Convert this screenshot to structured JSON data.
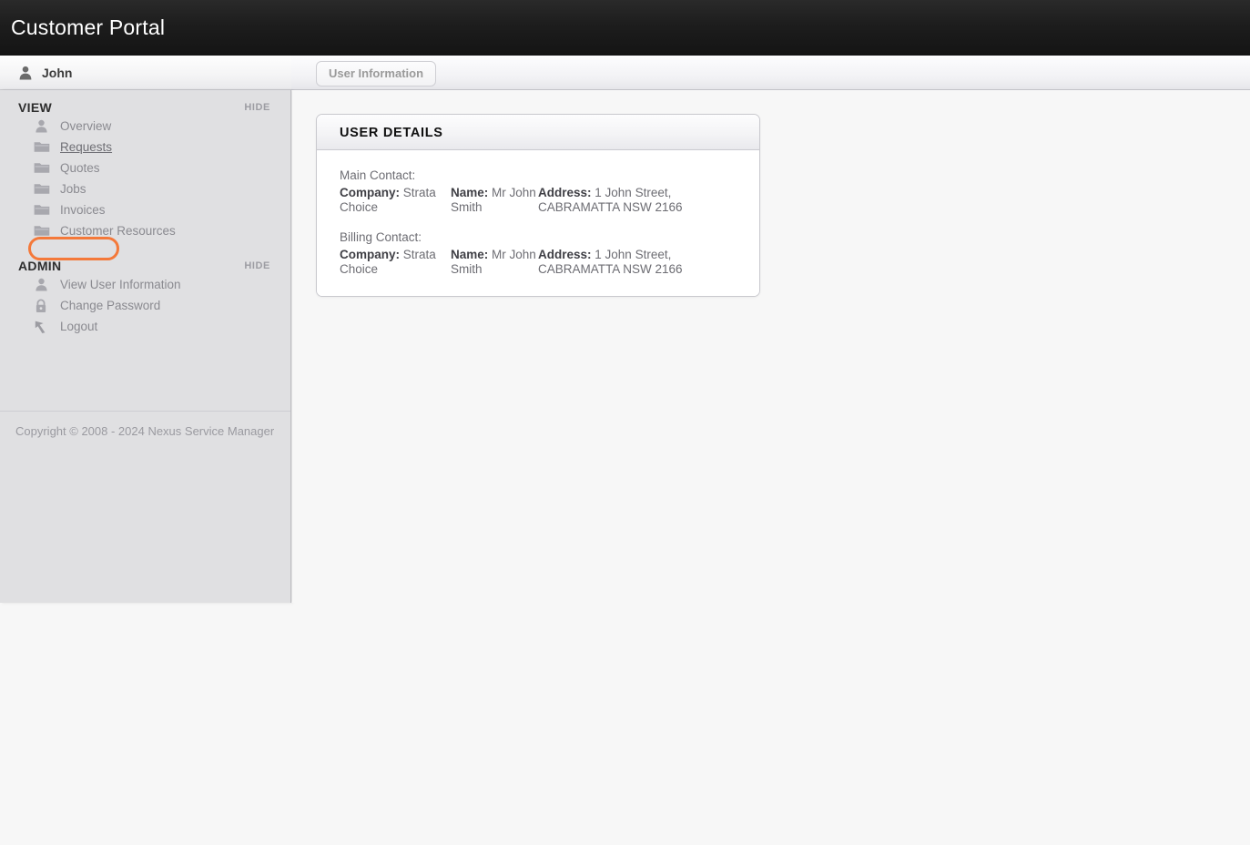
{
  "header": {
    "title": "Customer Portal"
  },
  "user": {
    "name": "John",
    "avatar_icon": "person-icon"
  },
  "toolbar": {
    "tabs": [
      {
        "label": "User Information",
        "active": true
      }
    ]
  },
  "sidebar": {
    "sections": [
      {
        "title": "VIEW",
        "hide_label": "HIDE",
        "items": [
          {
            "label": "Overview",
            "icon": "person-icon",
            "highlighted": false
          },
          {
            "label": "Requests",
            "icon": "folder-icon",
            "highlighted": true
          },
          {
            "label": "Quotes",
            "icon": "folder-icon",
            "highlighted": false
          },
          {
            "label": "Jobs",
            "icon": "folder-icon",
            "highlighted": false
          },
          {
            "label": "Invoices",
            "icon": "folder-icon",
            "highlighted": false
          },
          {
            "label": "Customer Resources",
            "icon": "folder-icon",
            "highlighted": false
          }
        ]
      },
      {
        "title": "ADMIN",
        "hide_label": "HIDE",
        "items": [
          {
            "label": "View User Information",
            "icon": "person-icon",
            "highlighted": false
          },
          {
            "label": "Change Password",
            "icon": "lock-icon",
            "highlighted": false
          },
          {
            "label": "Logout",
            "icon": "logout-arrow-icon",
            "highlighted": false
          }
        ]
      }
    ],
    "footer": {
      "copyright": "Copyright © 2008 - 2024 Nexus Service Manager"
    }
  },
  "main": {
    "panel": {
      "title": "USER DETAILS",
      "contacts": [
        {
          "heading": "Main Contact:",
          "company_label": "Company:",
          "company_value": "Strata Choice",
          "name_label": "Name:",
          "name_value": "Mr John Smith",
          "address_label": "Address:",
          "address_value": "1 John Street, CABRAMATTA NSW 2166"
        },
        {
          "heading": "Billing Contact:",
          "company_label": "Company:",
          "company_value": "Strata Choice",
          "name_label": "Name:",
          "name_value": "Mr John Smith",
          "address_label": "Address:",
          "address_value": "1 John Street, CABRAMATTA NSW 2166"
        }
      ]
    }
  },
  "colors": {
    "highlight_ring": "#f4793a",
    "header_background": "#1a1a1a",
    "sidebar_background": "#e0e0e2",
    "page_background": "#f7f7f7"
  }
}
